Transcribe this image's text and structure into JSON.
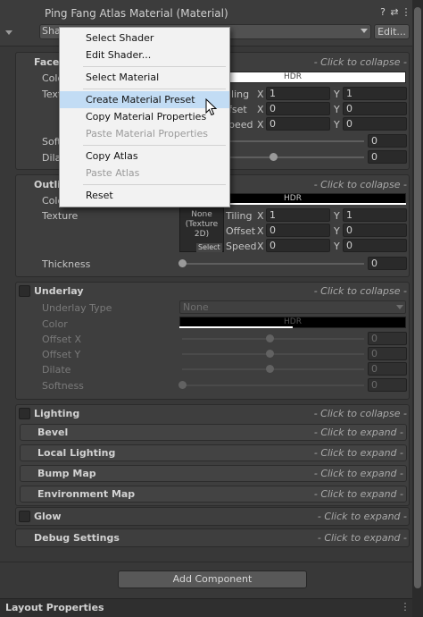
{
  "header": {
    "title": "Ping Fang Atlas Material (Material)",
    "shader_label": "Shader",
    "shader_prefix": "Sha",
    "edit_label": "Edit...",
    "help_icon": "question-icon",
    "settings_icon": "sliders-icon",
    "more_icon": "more-icon"
  },
  "common": {
    "collapse": "- Click to collapse -",
    "expand": "- Click to expand -",
    "hdr": "HDR",
    "x": "X",
    "y": "Y",
    "tiling": "Tiling",
    "offset": "Offset",
    "speed": "Speed",
    "tiling_partial": "iling",
    "offset_partial": "fset",
    "speed_partial": "peed"
  },
  "face": {
    "label": "Face",
    "color_label": "Color",
    "color_partial": "Colo",
    "texture_partial": "Text",
    "softness_partial": "Soft",
    "dilate_partial": "Dila",
    "tiling": [
      "1",
      "1"
    ],
    "offset": [
      "0",
      "0"
    ],
    "speed": [
      "0",
      "0"
    ],
    "softness": "0",
    "dilate": "0",
    "softness_level": 0.0,
    "dilate_level": 0.5
  },
  "outline": {
    "label_partial": "Outli",
    "color_partial": "Colo",
    "texture_label": "Texture",
    "texture_none": "None",
    "texture_type": "(Texture 2D)",
    "select": "Select",
    "tiling": [
      "1",
      "1"
    ],
    "offset": [
      "0",
      "0"
    ],
    "speed": [
      "0",
      "0"
    ],
    "thickness_label": "Thickness",
    "thickness": "0",
    "thickness_level": 0.0
  },
  "underlay": {
    "label": "Underlay",
    "type_label": "Underlay Type",
    "type_value": "None",
    "color_label": "Color",
    "offset_x_label": "Offset X",
    "offset_y_label": "Offset Y",
    "dilate_label": "Dilate",
    "softness_label": "Softness",
    "offset_x": "0",
    "offset_y": "0",
    "dilate": "0",
    "softness": "0"
  },
  "lighting": {
    "label": "Lighting",
    "sub": [
      "Bevel",
      "Local Lighting",
      "Bump Map",
      "Environment Map"
    ]
  },
  "glow": {
    "label": "Glow"
  },
  "debug": {
    "label": "Debug Settings"
  },
  "add_component": "Add Component",
  "layout_properties": "Layout Properties",
  "context_menu": {
    "items": [
      {
        "label": "Select Shader",
        "enabled": true
      },
      {
        "label": "Edit Shader...",
        "enabled": true
      },
      {
        "label": "Select Material",
        "enabled": true
      },
      {
        "label": "Create Material Preset",
        "enabled": true,
        "highlighted": true
      },
      {
        "label": "Copy Material Properties",
        "enabled": true
      },
      {
        "label": "Paste Material Properties",
        "enabled": false
      },
      {
        "label": "Copy Atlas",
        "enabled": true
      },
      {
        "label": "Paste Atlas",
        "enabled": false
      },
      {
        "label": "Reset",
        "enabled": true
      }
    ]
  }
}
